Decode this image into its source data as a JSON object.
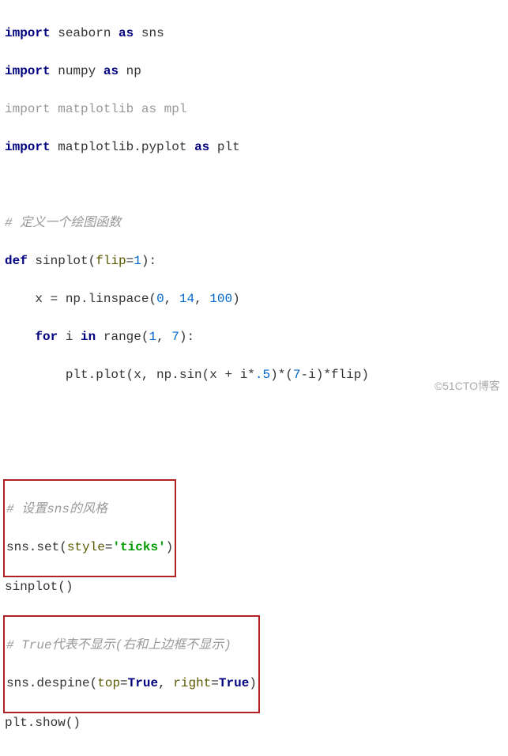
{
  "chart_data": {
    "type": "table",
    "title": "Python code snippet — seaborn plot setup",
    "language": "python",
    "lines": [
      "import seaborn as sns",
      "import numpy as np",
      "import matplotlib as mpl",
      "import matplotlib.pyplot as plt",
      "",
      "# 定义一个绘图函数",
      "def sinplot(flip=1):",
      "    x = np.linspace(0, 14, 100)",
      "    for i in range(1, 7):",
      "        plt.plot(x, np.sin(x + i*.5)*(7-i)*flip)",
      "",
      "",
      "# 设置sns的风格",
      "sns.set(style='ticks')",
      "sinplot()",
      "# True代表不显示(右和上边框不显示)",
      "sns.despine(top=True, right=True)",
      "plt.show()"
    ],
    "highlighted_blocks": [
      {
        "lines": [
          12,
          13
        ],
        "note": "设置sns的风格 - sns.set(style='ticks')"
      },
      {
        "lines": [
          15,
          16
        ],
        "note": "True代表不显示 - sns.despine(top=True, right=True)"
      }
    ],
    "greyed_lines": [
      2,
      3
    ]
  },
  "tokens": {
    "import": "import",
    "as": "as",
    "def": "def",
    "for": "for",
    "in": "in",
    "seaborn": "seaborn",
    "sns": "sns",
    "numpy": "numpy",
    "np": "np",
    "matplotlib": "matplotlib",
    "mpl": "mpl",
    "matplotlib_pyplot": "matplotlib.pyplot",
    "plt": "plt",
    "comment_def_fn": "# 定义一个绘图函数",
    "sinplot": "sinplot",
    "flip": "flip",
    "eq1": "=",
    "one": "1",
    "x": "x",
    "linspace": "np.linspace",
    "zero": "0",
    "fourteen": "14",
    "hundred": "100",
    "i": "i",
    "range": "range",
    "seven": "7",
    "pltplot": "plt.plot",
    "npsin": "np.sin",
    "half": ".5",
    "sevenminus": "7",
    "comment_set_style": "# 设置sns的风格",
    "snsset": "sns.set",
    "style": "style",
    "ticks": "'ticks'",
    "sinplot_call": "sinplot()",
    "comment_true": "# True代表不显示(右和上边框不显示)",
    "snsdespine": "sns.despine",
    "top": "top",
    "true1": "True",
    "right": "right",
    "true2": "True",
    "pltshow": "plt.show()"
  },
  "watermark": "©51CTO博客"
}
